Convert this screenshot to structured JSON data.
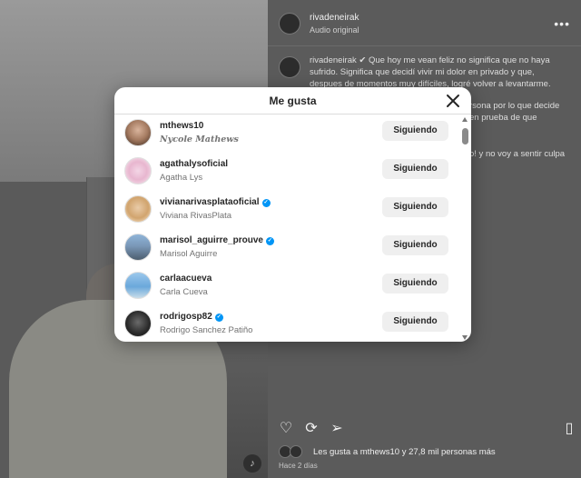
{
  "post": {
    "username": "rivadeneirak",
    "audio": "Audio original",
    "caption_lines": [
      "rivadeneirak ✔ Que hoy me vean feliz no significa que no haya",
      "sufrido. Significa que decidí vivir mi dolor en privado y que,",
      "despues de momentos muy difíciles, logré volver a levantarme."
    ],
    "caption_tail_1": "rsona por lo que decide",
    "caption_tail_2": "en prueba de que",
    "caption_tail_3": "o! y no voy a sentir culpa",
    "likes_text": "Les gusta a mthews10 y 27,8 mil personas más",
    "time_ago": "Hace 2 días"
  },
  "modal": {
    "title": "Me gusta",
    "users": [
      {
        "username": "mthews10",
        "fullname": "Nycole Mathews",
        "verified": false,
        "button": "Siguiendo"
      },
      {
        "username": "agathalysoficial",
        "fullname": "Agatha Lys",
        "verified": false,
        "button": "Siguiendo"
      },
      {
        "username": "vivianarivasplataoficial",
        "fullname": "Viviana RivasPlata",
        "verified": true,
        "button": "Siguiendo"
      },
      {
        "username": "marisol_aguirre_prouve",
        "fullname": "Marisol Aguirre",
        "verified": true,
        "button": "Siguiendo"
      },
      {
        "username": "carlaacueva",
        "fullname": "Carla Cueva",
        "verified": false,
        "button": "Siguiendo"
      },
      {
        "username": "rodrigosp82",
        "fullname": "Rodrigo Sanchez Patiño",
        "verified": true,
        "button": "Siguiendo"
      }
    ]
  },
  "colors": {
    "verified": "#0095f6",
    "button_bg": "#efefef",
    "overlay": "#5b5b5b"
  },
  "icons": [
    "more-icon",
    "close-icon",
    "heart-icon",
    "comment-icon",
    "share-icon",
    "bookmark-icon",
    "verified-icon",
    "audio-icon"
  ]
}
